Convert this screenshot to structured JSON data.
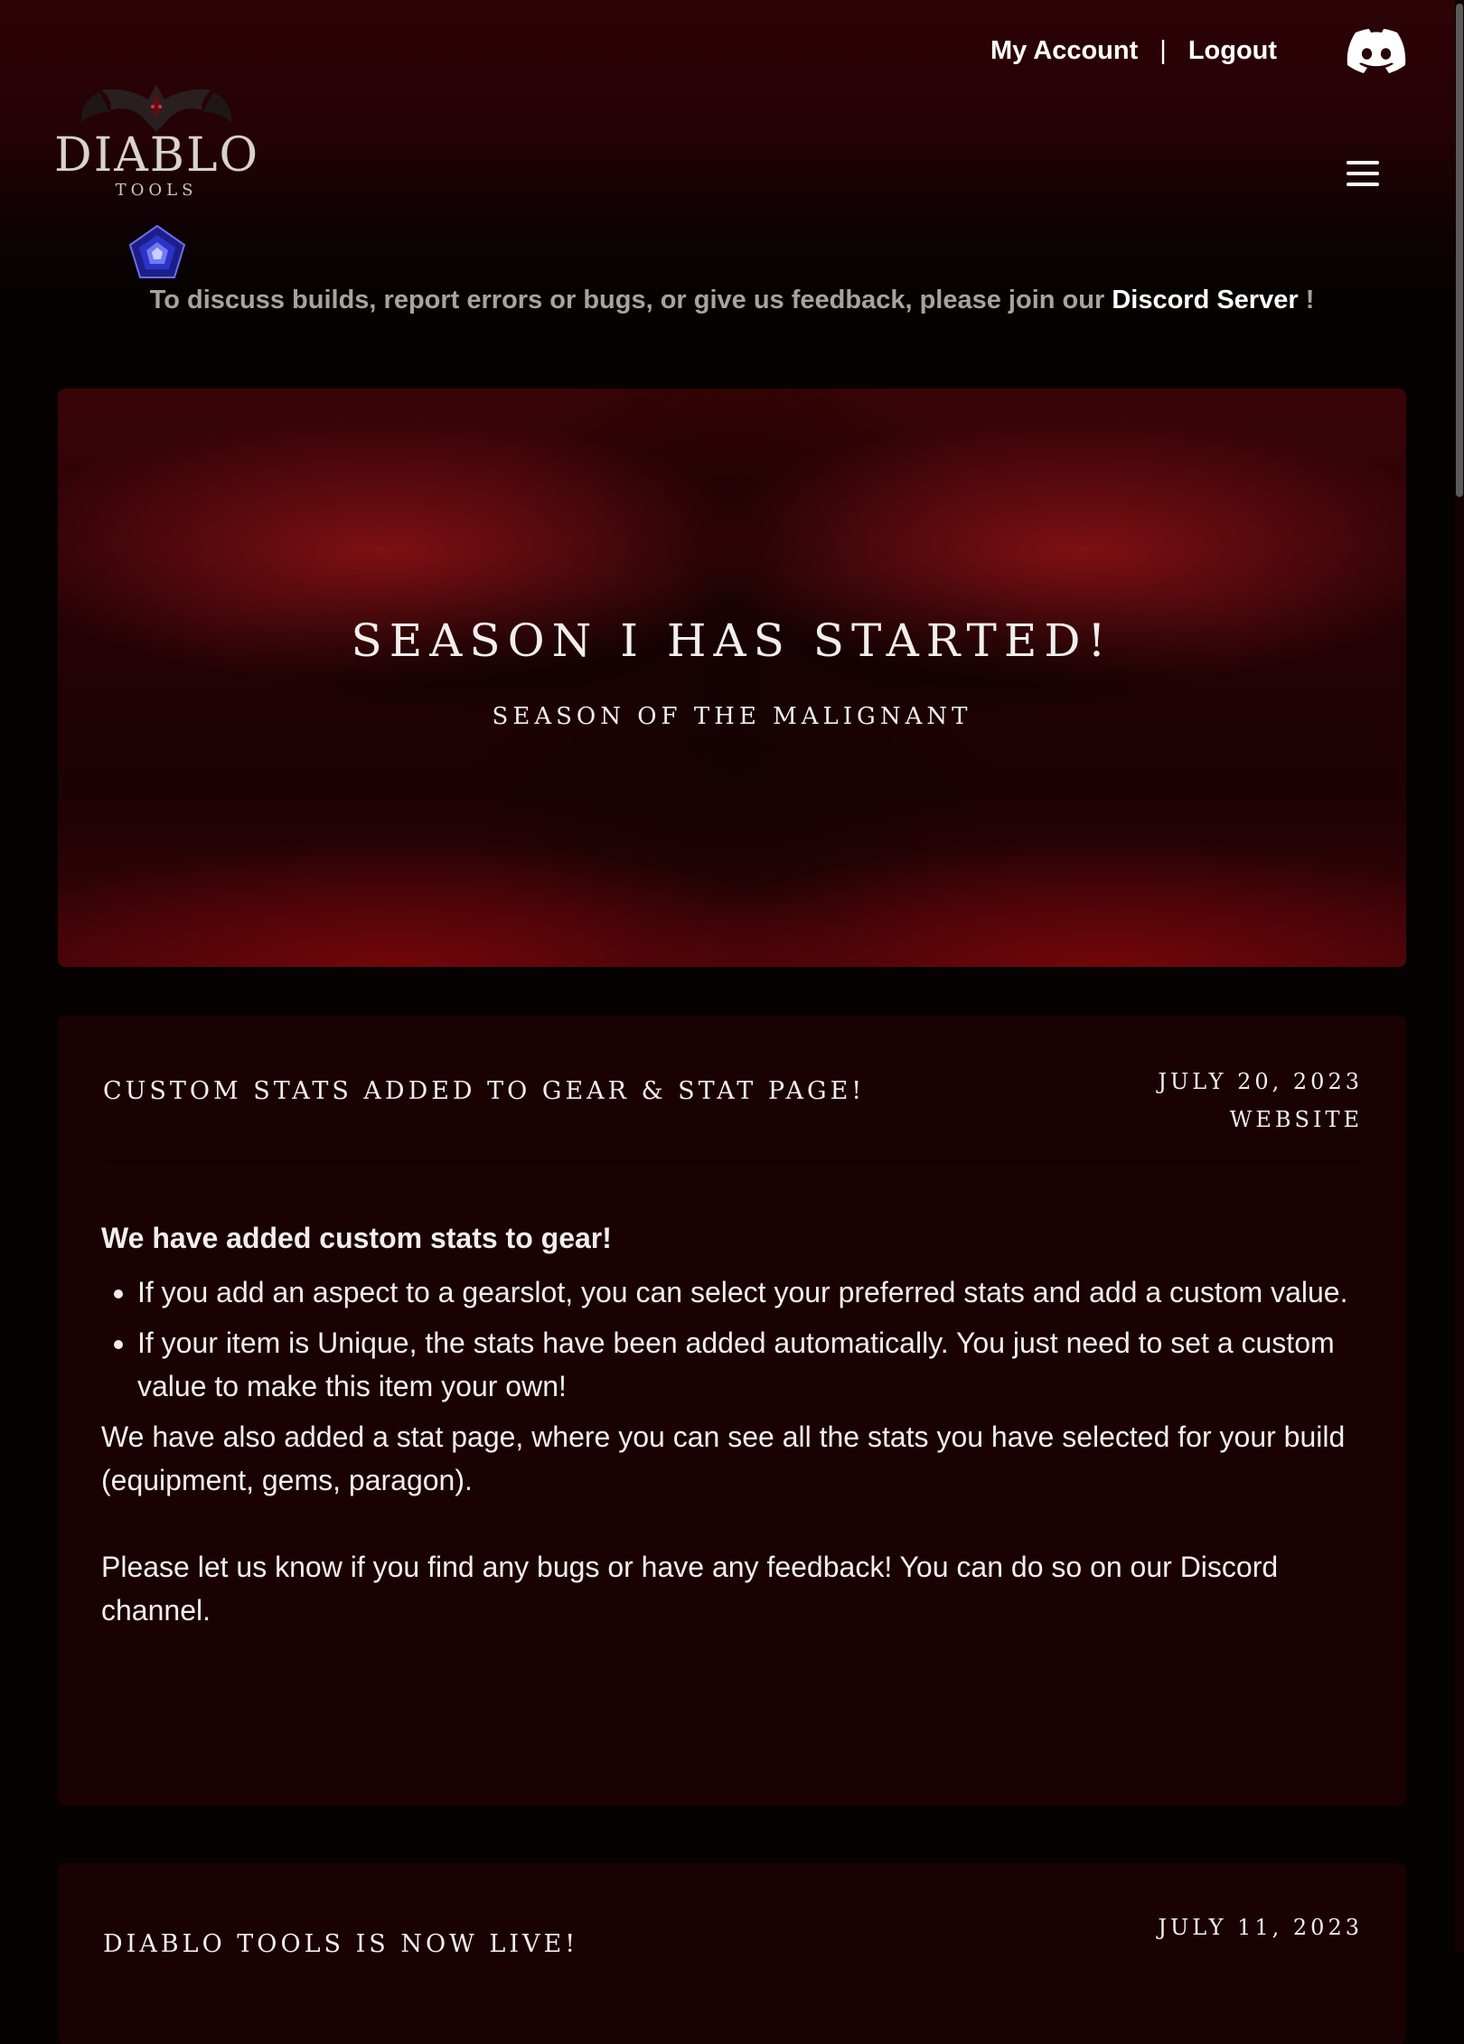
{
  "header": {
    "my_account": "My Account",
    "separator": "|",
    "logout": "Logout",
    "discord_icon": "discord-icon",
    "menu_icon": "hamburger-menu-icon"
  },
  "logo": {
    "text": "DIABLO",
    "sub": "TOOLS"
  },
  "notice": {
    "text": "To discuss builds, report errors or bugs, or give us feedback, please join our ",
    "link": "Discord Server",
    "suffix": " !"
  },
  "hero": {
    "title": "SEASON I HAS STARTED!",
    "subtitle": "SEASON OF THE MALIGNANT"
  },
  "posts": [
    {
      "title": "Custom stats added to gear & stat page!",
      "date": "July 20, 2023",
      "category": "Website",
      "lead": "We have added custom stats to gear!",
      "bullets": [
        "If you add an aspect to a gearslot, you can select your preferred stats and add a custom value.",
        "If your item is Unique, the stats have been added automatically. You just need to set a custom value to make this item your own!"
      ],
      "paragraphs": [
        "We have also added a stat page, where you can see all the stats you have selected for your build (equipment, gems, paragon).",
        "Please let us know if you find any bugs or have any feedback! You can do so on our Discord channel."
      ]
    },
    {
      "title": "Diablo Tools is now live!",
      "date": "July 11, 2023",
      "category": ""
    }
  ],
  "colors": {
    "background": "#060202",
    "header_red": "#2d0306",
    "card": "#1a0204",
    "text": "#f2eeee",
    "muted": "#a8a2a2"
  }
}
